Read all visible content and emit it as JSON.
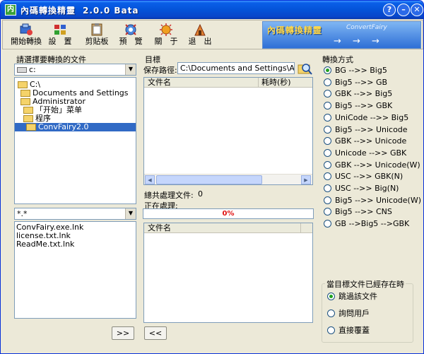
{
  "window": {
    "title": "內碼轉換精靈",
    "version": "2.0.0 Bata",
    "controls": [
      "?",
      "–",
      "✕"
    ]
  },
  "toolbar": {
    "items": [
      {
        "label": "開始轉換",
        "icon": "start-convert-icon"
      },
      {
        "label": "設　置",
        "icon": "settings-icon"
      },
      {
        "label": "剪貼板",
        "icon": "clipboard-icon"
      },
      {
        "label": "預　覽",
        "icon": "preview-icon"
      },
      {
        "label": "關　于",
        "icon": "about-icon"
      },
      {
        "label": "退　出",
        "icon": "exit-icon"
      }
    ],
    "banner": {
      "title": "內碼轉換精靈",
      "subtitle": "ConvertFairy",
      "arrows": "→ → →"
    }
  },
  "left": {
    "label": "請選擇要轉換的文件",
    "drive": "c:",
    "tree": [
      {
        "label": "C:\\",
        "selected": false
      },
      {
        "label": "Documents and Settings",
        "selected": false
      },
      {
        "label": "Administrator",
        "selected": false
      },
      {
        "label": "「开始」菜单",
        "selected": false
      },
      {
        "label": "程序",
        "selected": false
      },
      {
        "label": "ConvFairy2.0",
        "selected": true
      }
    ],
    "filter": "*.*",
    "files": [
      "ConvFairy.exe.lnk",
      "license.txt.lnk",
      "ReadMe.txt.lnk"
    ],
    "add_button": ">>"
  },
  "middle": {
    "label": "目標",
    "save_path_label": "保存路徑:",
    "save_path_value": "C:\\Documents and Settings\\Administrator",
    "table_headers": [
      "文件名",
      "耗時(秒)"
    ],
    "total_label": "總共處理文件:",
    "total_value": "0",
    "processing_label": "正在處理:",
    "progress_text": "0%",
    "progress_value": 0,
    "list_header": "文件名",
    "remove_button": "<<"
  },
  "right": {
    "label": "轉換方式",
    "modes": [
      {
        "label": "BG -->> Big5",
        "checked": true
      },
      {
        "label": "Big5 -->> GB",
        "checked": false
      },
      {
        "label": "GBK -->> Big5",
        "checked": false
      },
      {
        "label": "Big5 -->> GBK",
        "checked": false
      },
      {
        "label": "UniCode -->> Big5",
        "checked": false
      },
      {
        "label": "Big5 -->> Unicode",
        "checked": false
      },
      {
        "label": "GBK -->> Unicode",
        "checked": false
      },
      {
        "label": "Unicode -->> GBK",
        "checked": false
      },
      {
        "label": "GBK -->> Unicode(W)",
        "checked": false
      },
      {
        "label": "USC -->> GBK(N)",
        "checked": false
      },
      {
        "label": "USC -->> Big(N)",
        "checked": false
      },
      {
        "label": "Big5 -->> Unicode(W)",
        "checked": false
      },
      {
        "label": "Big5 -->> CNS",
        "checked": false
      },
      {
        "label": "GB -->Big5 -->GBK",
        "checked": false
      }
    ],
    "exists_group": {
      "label": "當目標文件已經存在時",
      "options": [
        {
          "label": "跳過該文件",
          "checked": true
        },
        {
          "label": "詢問用戶",
          "checked": false
        },
        {
          "label": "直接覆蓋",
          "checked": false
        }
      ]
    }
  }
}
